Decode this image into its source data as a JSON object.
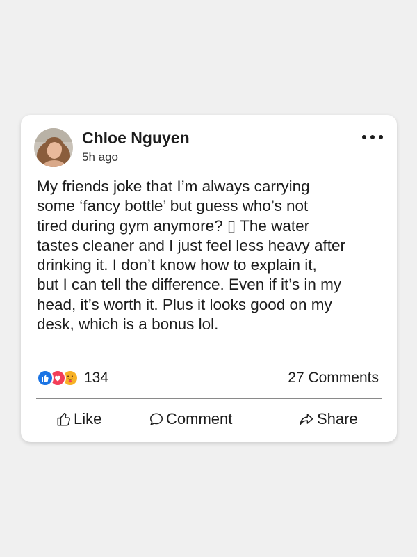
{
  "post": {
    "author": "Chloe Nguyen",
    "timestamp": "5h ago",
    "body_lines": [
      "My friends joke that I’m always carrying",
      "some ‘fancy bottle’ but guess who’s not",
      "tired during gym anymore? ▯ The water",
      "tastes cleaner and I just feel less heavy after",
      "drinking it. I don’t know how to explain it,",
      "but I can tell the difference. Even if it’s in my",
      "head, it’s worth it. Plus it looks good on my",
      "desk, which is a bonus lol."
    ],
    "reaction_count": "134",
    "comments_count": "27 Comments"
  },
  "actions": {
    "like_label": "Like",
    "comment_label": "Comment",
    "share_label": "Share"
  },
  "icons": {
    "more": "more-options-icon",
    "like": "thumbs-up-icon",
    "comment": "speech-bubble-icon",
    "share": "share-arrow-icon",
    "reactions": [
      "like-reaction-icon",
      "love-reaction-icon",
      "care-reaction-icon"
    ]
  },
  "colors": {
    "like_reaction": "#1b74e4",
    "love_reaction": "#f33e58",
    "care_reaction": "#f7b125",
    "text": "#1c1c1c",
    "card_background": "#ffffff"
  }
}
